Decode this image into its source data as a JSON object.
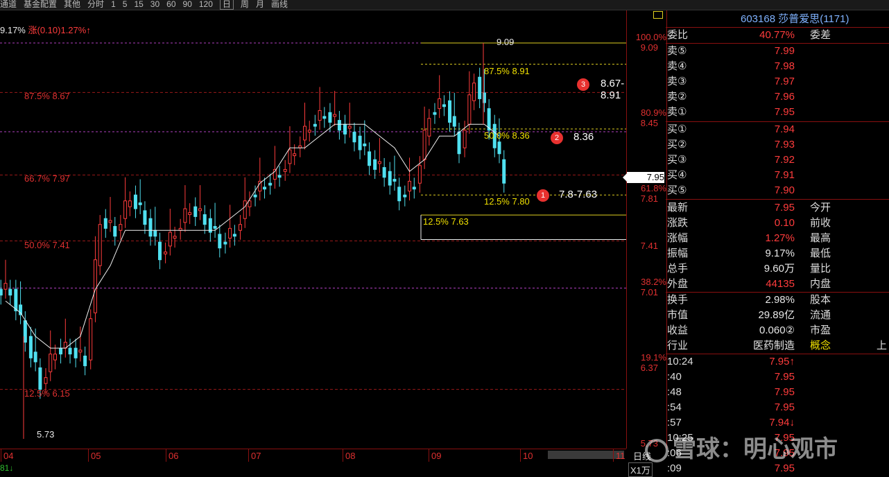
{
  "toolbar": {
    "items": [
      "通道",
      "基金配置",
      "其他",
      "分时",
      "1",
      "5",
      "15",
      "30",
      "60",
      "90",
      "120",
      "日",
      "周",
      "月",
      "画线"
    ],
    "selected": "日"
  },
  "chart": {
    "quote_prefix": "9.17%",
    "quote_change": "涨(0.10)1.27%↑",
    "fib_left_labels": [
      {
        "text": "87.5% 8.67",
        "price": 8.67
      },
      {
        "text": "66.7% 7.97",
        "price": 7.97
      },
      {
        "text": "50.0% 7.41",
        "price": 7.41
      },
      {
        "text": "12.5% 6.15",
        "price": 6.15
      }
    ],
    "low_label": "5.73",
    "high_label": "9.09",
    "fib_yellow_labels": [
      {
        "text": "87.5% 8.91",
        "price": 8.91
      },
      {
        "text": "50.0% 8.36",
        "price": 8.36
      },
      {
        "text": "12.5% 7.80",
        "price": 7.8
      },
      {
        "text": "12.5% 7.63",
        "price": 7.63
      }
    ],
    "annotations": [
      {
        "num": "3",
        "text": "8.67-8.91"
      },
      {
        "num": "2",
        "text": "8.36"
      },
      {
        "num": "1",
        "text": "7.8-7.63"
      }
    ],
    "right_axis": [
      {
        "pct": "100.0%",
        "price": "9.09",
        "value": 9.09
      },
      {
        "pct": "80.9%",
        "price": "8.45",
        "value": 8.45
      },
      {
        "pct": "61.8%",
        "price": "7.81",
        "value": 7.81
      },
      {
        "pct": "",
        "price": "7.41",
        "value": 7.41
      },
      {
        "pct": "38.2%",
        "price": "7.01",
        "value": 7.01
      },
      {
        "pct": "19.1%",
        "price": "6.37",
        "value": 6.37
      },
      {
        "pct": "",
        "price": "5.73",
        "value": 5.73
      }
    ],
    "current_price": "7.95",
    "x_months": [
      "04",
      "05",
      "06",
      "07",
      "08",
      "09",
      "10",
      "11"
    ],
    "period_button": "日线",
    "zoom_button": "X1万",
    "status_text": "81↓"
  },
  "chart_data": {
    "type": "candlestick",
    "ylim": [
      5.73,
      9.09
    ],
    "x": [
      "04",
      "05",
      "06",
      "07",
      "08",
      "09",
      "10"
    ],
    "close": [
      7.0,
      6.6,
      6.2,
      6.5,
      6.5,
      6.4,
      7.6,
      7.5,
      7.8,
      7.6,
      7.3,
      7.5,
      7.7,
      7.6,
      7.4,
      7.5,
      7.8,
      7.9,
      8.0,
      8.2,
      8.4,
      8.5,
      8.4,
      8.3,
      8.1,
      8.0,
      7.8,
      7.9,
      8.5,
      8.6,
      8.2,
      8.8,
      8.4,
      7.95
    ],
    "ma": [
      6.9,
      6.8,
      6.6,
      6.5,
      6.5,
      6.6,
      7.0,
      7.2,
      7.5,
      7.5,
      7.5,
      7.5,
      7.5,
      7.5,
      7.5,
      7.6,
      7.7,
      7.9,
      8.0,
      8.2,
      8.2,
      8.3,
      8.4,
      8.4,
      8.4,
      8.3,
      8.2,
      8.0,
      8.1,
      8.3,
      8.3,
      8.4,
      8.4,
      8.3
    ]
  },
  "panel": {
    "header": "603168 莎普爱思(1171)",
    "weibi": {
      "label": "委比",
      "value": "40.77%",
      "right": "委差"
    },
    "sells": [
      {
        "label": "卖⑤",
        "price": "7.99"
      },
      {
        "label": "卖④",
        "price": "7.98"
      },
      {
        "label": "卖③",
        "price": "7.97"
      },
      {
        "label": "卖②",
        "price": "7.96"
      },
      {
        "label": "卖①",
        "price": "7.95"
      }
    ],
    "buys": [
      {
        "label": "买①",
        "price": "7.94"
      },
      {
        "label": "买②",
        "price": "7.93"
      },
      {
        "label": "买③",
        "price": "7.92"
      },
      {
        "label": "买④",
        "price": "7.91"
      },
      {
        "label": "买⑤",
        "price": "7.90"
      }
    ],
    "stats1": [
      {
        "label": "最新",
        "value": "7.95",
        "right": "今开",
        "cls": "red"
      },
      {
        "label": "涨跌",
        "value": "0.10",
        "right": "前收",
        "cls": "red"
      },
      {
        "label": "涨幅",
        "value": "1.27%",
        "right": "最高",
        "cls": "red"
      },
      {
        "label": "振幅",
        "value": "9.17%",
        "right": "最低",
        "cls": "white"
      },
      {
        "label": "总手",
        "value": "9.60万",
        "right": "量比",
        "cls": "white"
      },
      {
        "label": "外盘",
        "value": "44135",
        "right": "内盘",
        "cls": "red"
      }
    ],
    "stats2": [
      {
        "label": "换手",
        "value": "2.98%",
        "right": "股本",
        "cls": "white"
      },
      {
        "label": "市值",
        "value": "29.89亿",
        "right": "流通",
        "cls": "white"
      },
      {
        "label": "收益",
        "value": "0.060②",
        "right": "市盈",
        "cls": "white"
      }
    ],
    "industry": {
      "label": "行业",
      "value": "医药制造",
      "right": "概念",
      "extra": "上"
    },
    "ticks": [
      {
        "time": "10:24",
        "price": "7.95↑",
        "cls": "red"
      },
      {
        "time": ":40",
        "price": "7.95",
        "cls": "red"
      },
      {
        "time": ":48",
        "price": "7.95",
        "cls": "red"
      },
      {
        "time": ":54",
        "price": "7.95",
        "cls": "red"
      },
      {
        "time": ":57",
        "price": "7.94↓",
        "cls": "red"
      },
      {
        "time": "10:25",
        "price": "7.95",
        "cls": "red"
      },
      {
        "time": ":06",
        "price": "7.95",
        "cls": "red"
      },
      {
        "time": ":09",
        "price": "7.95",
        "cls": "red"
      }
    ]
  },
  "watermark": "雪球：明心观市"
}
